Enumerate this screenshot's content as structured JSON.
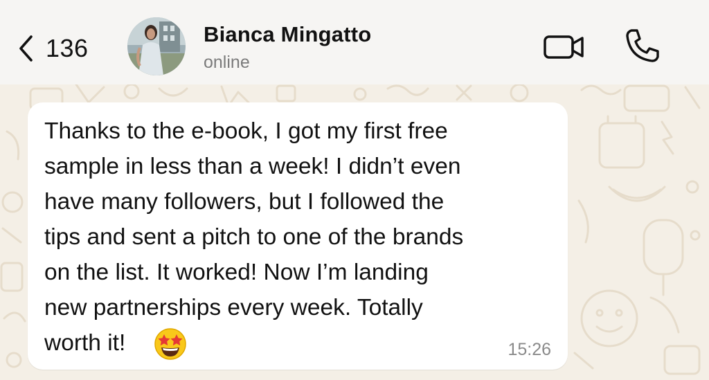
{
  "header": {
    "back_count": "136",
    "contact_name": "Bianca Mingatto",
    "contact_status": "online",
    "icons": {
      "back": "chevron-left-icon",
      "video": "video-camera-icon",
      "call": "phone-icon"
    }
  },
  "message": {
    "text": "Thanks to the e-book, I got my first free\nsample in less than a week! I didn’t even\nhave many followers, but I followed the\ntips and sent a pitch to one of the brands\non the list. It worked! Now I’m landing\nnew partnerships every week. Totally\nworth it!",
    "emoji": "star-struck-emoji",
    "time": "15:26"
  },
  "colors": {
    "chat_background": "#f4efe6",
    "header_background": "#f6f5f3",
    "bubble_background": "#ffffff",
    "status_gray": "#7b7b7b"
  }
}
